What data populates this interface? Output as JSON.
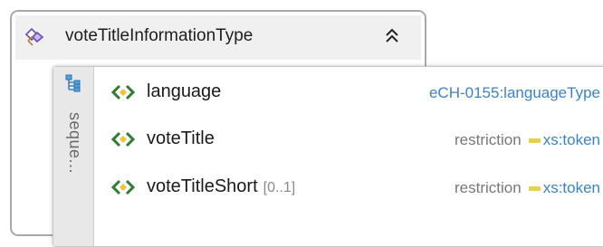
{
  "complex_type": {
    "title": "voteTitleInformationType",
    "icon": "complex-type-icon",
    "collapse_icon": "collapse-up-icon"
  },
  "sequence": {
    "label": "seque...",
    "icon": "sequence-icon",
    "elements": [
      {
        "name": "language",
        "occurs": "",
        "type_prefix": "",
        "type": "eCH-0155:languageType"
      },
      {
        "name": "voteTitle",
        "occurs": "",
        "type_prefix": "restriction",
        "type": "xs:token"
      },
      {
        "name": "voteTitleShort",
        "occurs": "[0..1]",
        "type_prefix": "restriction",
        "type": "xs:token"
      }
    ]
  },
  "colors": {
    "element_icon": "#2e7d32",
    "type_link": "#3b83c9",
    "restriction_bar": "#e8d04a"
  }
}
